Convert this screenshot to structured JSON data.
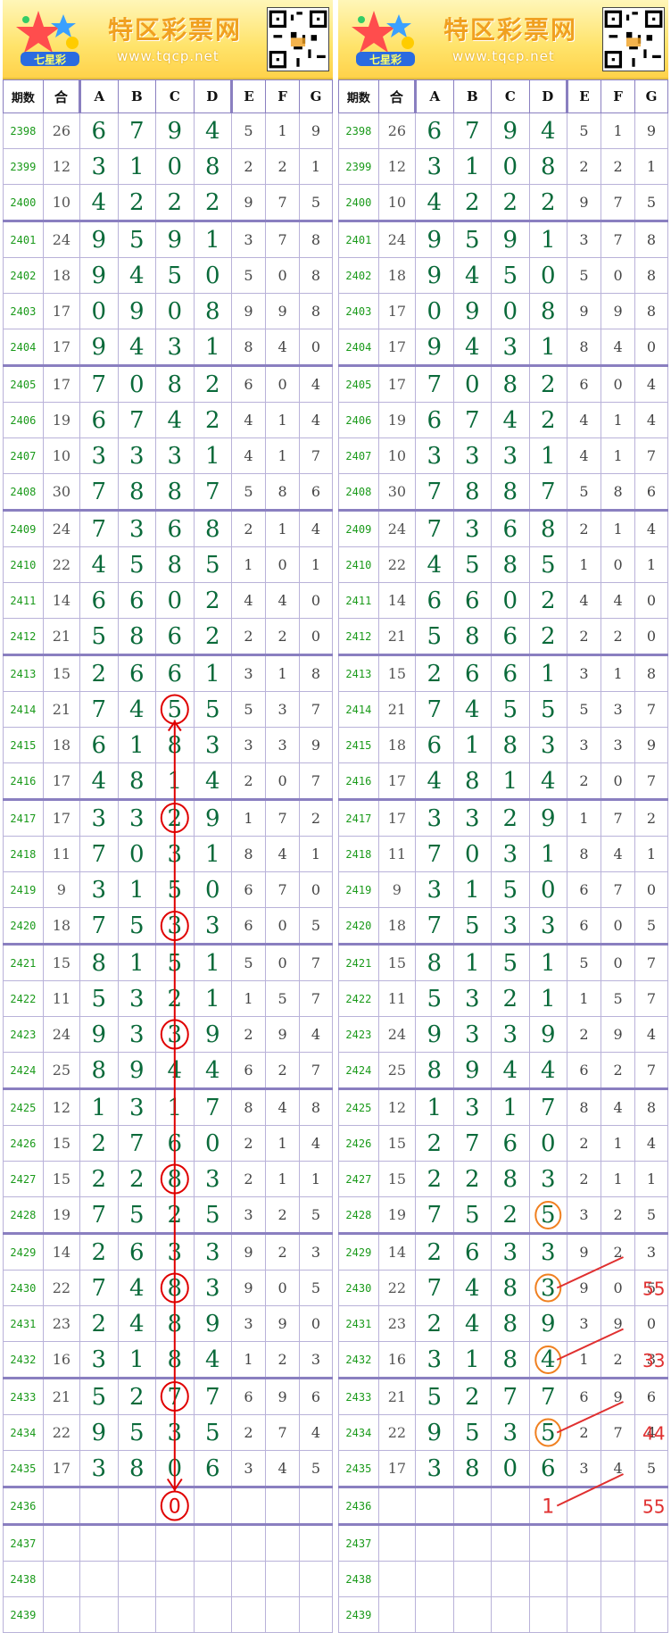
{
  "banner": {
    "site_name": "特区彩票网",
    "site_url": "www.tqcp.net",
    "logo_text": "七星彩"
  },
  "headers": [
    "期数",
    "合",
    "A",
    "B",
    "C",
    "D",
    "E",
    "F",
    "G"
  ],
  "rows": [
    {
      "period": "2398",
      "sum": "26",
      "A": "6",
      "B": "7",
      "C": "9",
      "D": "4",
      "E": "5",
      "F": "1",
      "G": "9"
    },
    {
      "period": "2399",
      "sum": "12",
      "A": "3",
      "B": "1",
      "C": "0",
      "D": "8",
      "E": "2",
      "F": "2",
      "G": "1"
    },
    {
      "period": "2400",
      "sum": "10",
      "A": "4",
      "B": "2",
      "C": "2",
      "D": "2",
      "E": "9",
      "F": "7",
      "G": "5"
    },
    {
      "period": "2401",
      "sum": "24",
      "A": "9",
      "B": "5",
      "C": "9",
      "D": "1",
      "E": "3",
      "F": "7",
      "G": "8"
    },
    {
      "period": "2402",
      "sum": "18",
      "A": "9",
      "B": "4",
      "C": "5",
      "D": "0",
      "E": "5",
      "F": "0",
      "G": "8"
    },
    {
      "period": "2403",
      "sum": "17",
      "A": "0",
      "B": "9",
      "C": "0",
      "D": "8",
      "E": "9",
      "F": "9",
      "G": "8"
    },
    {
      "period": "2404",
      "sum": "17",
      "A": "9",
      "B": "4",
      "C": "3",
      "D": "1",
      "E": "8",
      "F": "4",
      "G": "0"
    },
    {
      "period": "2405",
      "sum": "17",
      "A": "7",
      "B": "0",
      "C": "8",
      "D": "2",
      "E": "6",
      "F": "0",
      "G": "4"
    },
    {
      "period": "2406",
      "sum": "19",
      "A": "6",
      "B": "7",
      "C": "4",
      "D": "2",
      "E": "4",
      "F": "1",
      "G": "4"
    },
    {
      "period": "2407",
      "sum": "10",
      "A": "3",
      "B": "3",
      "C": "3",
      "D": "1",
      "E": "4",
      "F": "1",
      "G": "7"
    },
    {
      "period": "2408",
      "sum": "30",
      "A": "7",
      "B": "8",
      "C": "8",
      "D": "7",
      "E": "5",
      "F": "8",
      "G": "6"
    },
    {
      "period": "2409",
      "sum": "24",
      "A": "7",
      "B": "3",
      "C": "6",
      "D": "8",
      "E": "2",
      "F": "1",
      "G": "4"
    },
    {
      "period": "2410",
      "sum": "22",
      "A": "4",
      "B": "5",
      "C": "8",
      "D": "5",
      "E": "1",
      "F": "0",
      "G": "1"
    },
    {
      "period": "2411",
      "sum": "14",
      "A": "6",
      "B": "6",
      "C": "0",
      "D": "2",
      "E": "4",
      "F": "4",
      "G": "0"
    },
    {
      "period": "2412",
      "sum": "21",
      "A": "5",
      "B": "8",
      "C": "6",
      "D": "2",
      "E": "2",
      "F": "2",
      "G": "0"
    },
    {
      "period": "2413",
      "sum": "15",
      "A": "2",
      "B": "6",
      "C": "6",
      "D": "1",
      "E": "3",
      "F": "1",
      "G": "8"
    },
    {
      "period": "2414",
      "sum": "21",
      "A": "7",
      "B": "4",
      "C": "5",
      "D": "5",
      "E": "5",
      "F": "3",
      "G": "7"
    },
    {
      "period": "2415",
      "sum": "18",
      "A": "6",
      "B": "1",
      "C": "8",
      "D": "3",
      "E": "3",
      "F": "3",
      "G": "9"
    },
    {
      "period": "2416",
      "sum": "17",
      "A": "4",
      "B": "8",
      "C": "1",
      "D": "4",
      "E": "2",
      "F": "0",
      "G": "7"
    },
    {
      "period": "2417",
      "sum": "17",
      "A": "3",
      "B": "3",
      "C": "2",
      "D": "9",
      "E": "1",
      "F": "7",
      "G": "2"
    },
    {
      "period": "2418",
      "sum": "11",
      "A": "7",
      "B": "0",
      "C": "3",
      "D": "1",
      "E": "8",
      "F": "4",
      "G": "1"
    },
    {
      "period": "2419",
      "sum": "9",
      "A": "3",
      "B": "1",
      "C": "5",
      "D": "0",
      "E": "6",
      "F": "7",
      "G": "0"
    },
    {
      "period": "2420",
      "sum": "18",
      "A": "7",
      "B": "5",
      "C": "3",
      "D": "3",
      "E": "6",
      "F": "0",
      "G": "5"
    },
    {
      "period": "2421",
      "sum": "15",
      "A": "8",
      "B": "1",
      "C": "5",
      "D": "1",
      "E": "5",
      "F": "0",
      "G": "7"
    },
    {
      "period": "2422",
      "sum": "11",
      "A": "5",
      "B": "3",
      "C": "2",
      "D": "1",
      "E": "1",
      "F": "5",
      "G": "7"
    },
    {
      "period": "2423",
      "sum": "24",
      "A": "9",
      "B": "3",
      "C": "3",
      "D": "9",
      "E": "2",
      "F": "9",
      "G": "4"
    },
    {
      "period": "2424",
      "sum": "25",
      "A": "8",
      "B": "9",
      "C": "4",
      "D": "4",
      "E": "6",
      "F": "2",
      "G": "7"
    },
    {
      "period": "2425",
      "sum": "12",
      "A": "1",
      "B": "3",
      "C": "1",
      "D": "7",
      "E": "8",
      "F": "4",
      "G": "8"
    },
    {
      "period": "2426",
      "sum": "15",
      "A": "2",
      "B": "7",
      "C": "6",
      "D": "0",
      "E": "2",
      "F": "1",
      "G": "4"
    },
    {
      "period": "2427",
      "sum": "15",
      "A": "2",
      "B": "2",
      "C": "8",
      "D": "3",
      "E": "2",
      "F": "1",
      "G": "1"
    },
    {
      "period": "2428",
      "sum": "19",
      "A": "7",
      "B": "5",
      "C": "2",
      "D": "5",
      "E": "3",
      "F": "2",
      "G": "5"
    },
    {
      "period": "2429",
      "sum": "14",
      "A": "2",
      "B": "6",
      "C": "3",
      "D": "3",
      "E": "9",
      "F": "2",
      "G": "3"
    },
    {
      "period": "2430",
      "sum": "22",
      "A": "7",
      "B": "4",
      "C": "8",
      "D": "3",
      "E": "9",
      "F": "0",
      "G": "5"
    },
    {
      "period": "2431",
      "sum": "23",
      "A": "2",
      "B": "4",
      "C": "8",
      "D": "9",
      "E": "3",
      "F": "9",
      "G": "0"
    },
    {
      "period": "2432",
      "sum": "16",
      "A": "3",
      "B": "1",
      "C": "8",
      "D": "4",
      "E": "1",
      "F": "2",
      "G": "3"
    },
    {
      "period": "2433",
      "sum": "21",
      "A": "5",
      "B": "2",
      "C": "7",
      "D": "7",
      "E": "6",
      "F": "9",
      "G": "6"
    },
    {
      "period": "2434",
      "sum": "22",
      "A": "9",
      "B": "5",
      "C": "3",
      "D": "5",
      "E": "2",
      "F": "7",
      "G": "4"
    },
    {
      "period": "2435",
      "sum": "17",
      "A": "3",
      "B": "8",
      "C": "0",
      "D": "6",
      "E": "3",
      "F": "4",
      "G": "5"
    },
    {
      "period": "2436",
      "sum": "",
      "A": "",
      "B": "",
      "C": "",
      "D": "",
      "E": "",
      "F": "",
      "G": ""
    },
    {
      "period": "2437",
      "sum": "",
      "A": "",
      "B": "",
      "C": "",
      "D": "",
      "E": "",
      "F": "",
      "G": ""
    },
    {
      "period": "2438",
      "sum": "",
      "A": "",
      "B": "",
      "C": "",
      "D": "",
      "E": "",
      "F": "",
      "G": ""
    },
    {
      "period": "2439",
      "sum": "",
      "A": "",
      "B": "",
      "C": "",
      "D": "",
      "E": "",
      "F": "",
      "G": ""
    }
  ],
  "left_annotations": {
    "predicted_C_2436": "0"
  },
  "right_annotations": {
    "predicted_D_2436": "1",
    "notes": [
      "55",
      "33",
      "44",
      "55"
    ]
  },
  "colors": {
    "period_green": "#1a9a1a",
    "main_digit": "#0a6a3a",
    "grid_line": "#8a7fc0",
    "red_marker": "#e00000",
    "orange_marker": "#f08020"
  }
}
